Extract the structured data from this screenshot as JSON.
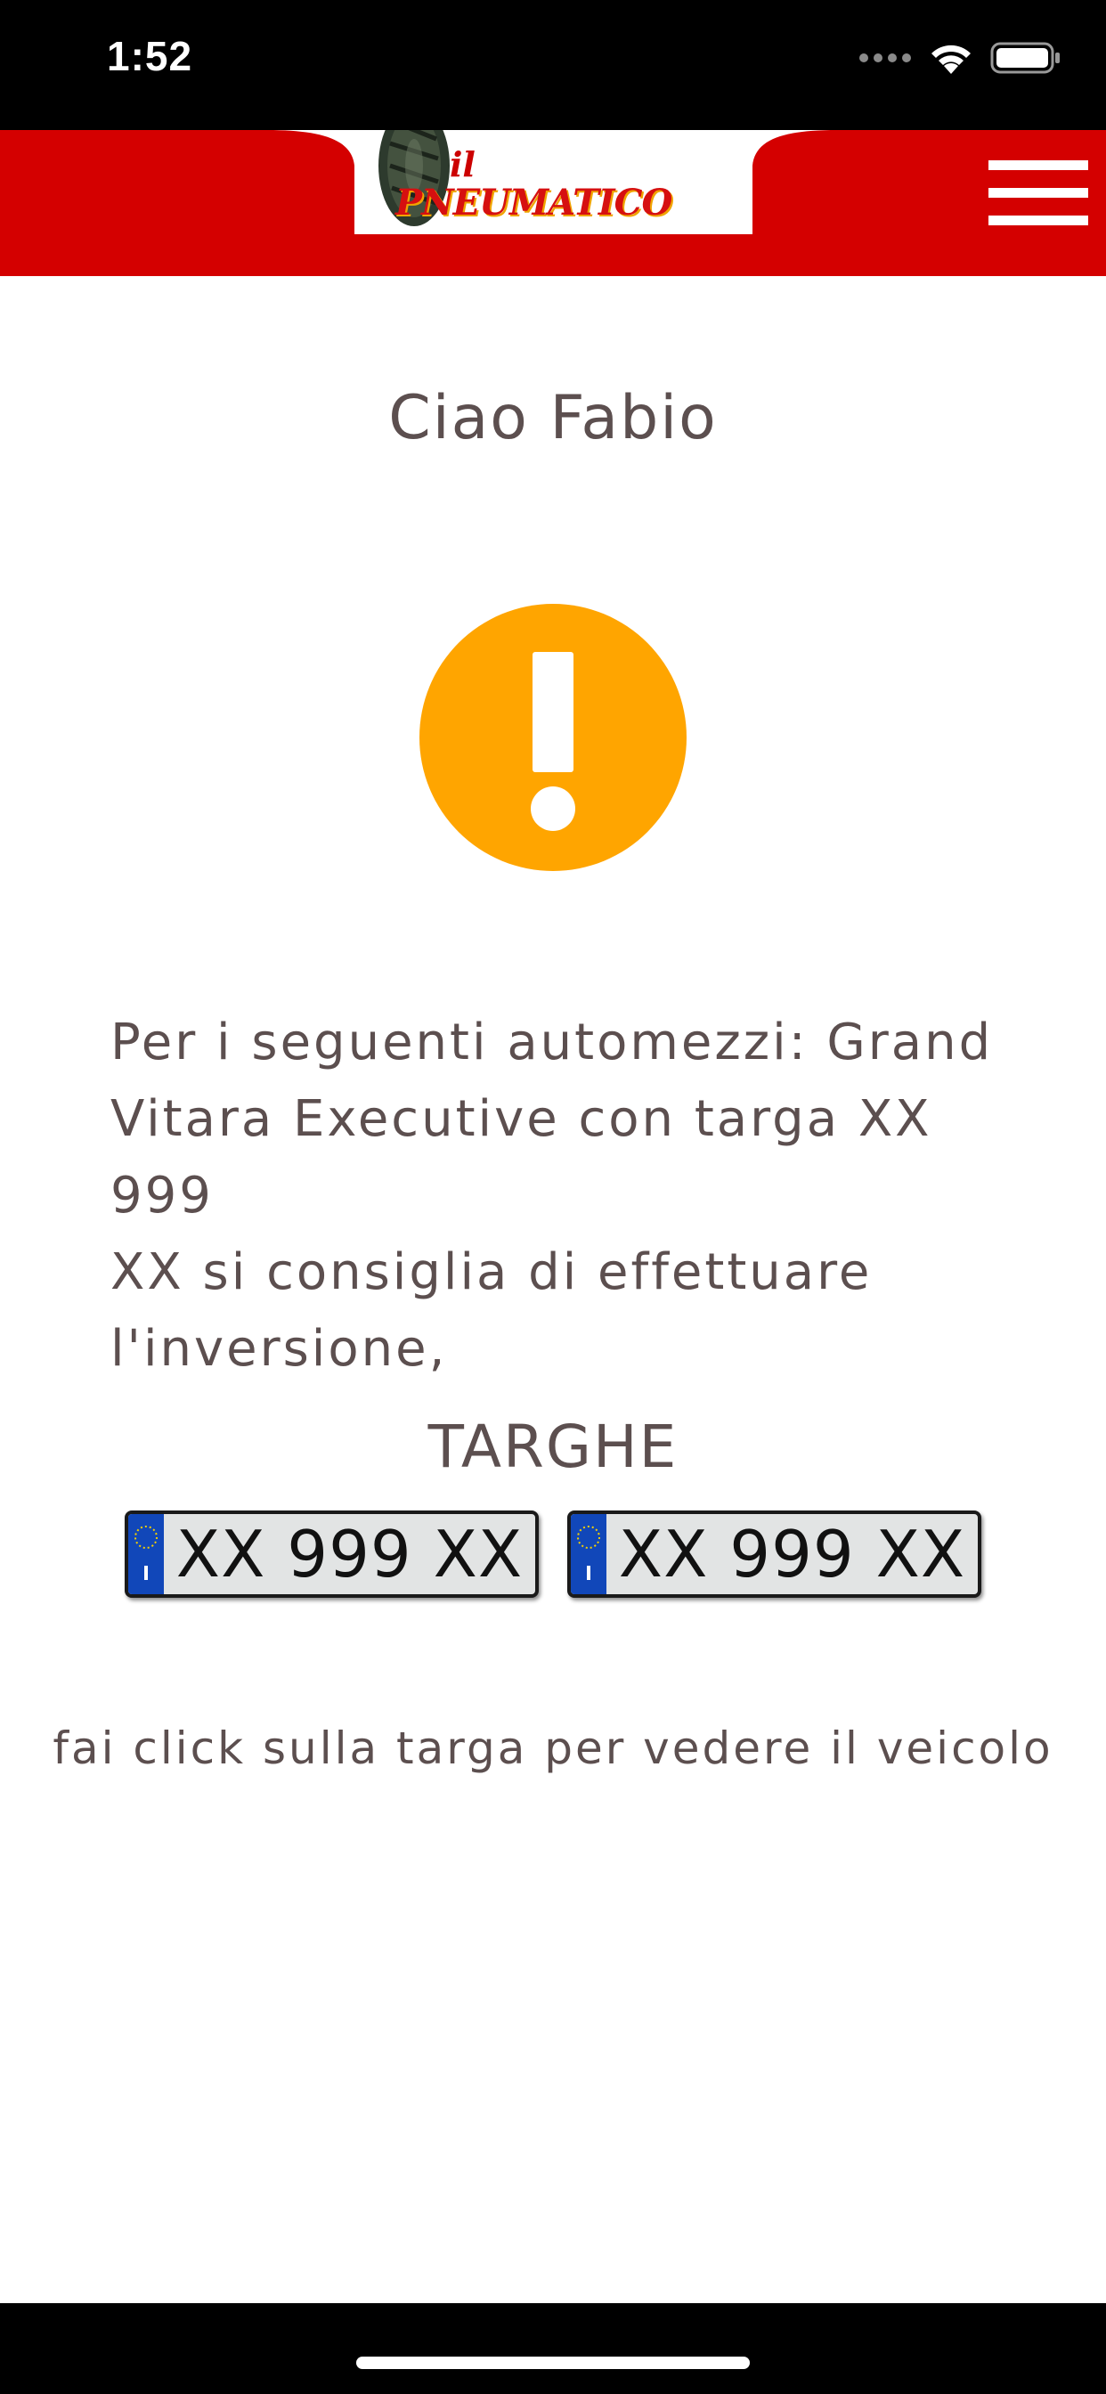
{
  "status_bar": {
    "time": "1:52",
    "icons": [
      "signal-dots-icon",
      "wifi-icon",
      "battery-icon"
    ]
  },
  "header": {
    "logo_text_small": "il",
    "logo_text_main": "PNEUMATICO",
    "menu_icon": "hamburger-menu-icon",
    "colors": {
      "background": "#d40000",
      "logo_red": "#d61010",
      "logo_orange": "#f0a400"
    }
  },
  "main": {
    "greeting": "Ciao Fabio",
    "alert_icon": "exclamation-circle-icon",
    "alert_color": "#ffa500",
    "message_lines": [
      "Per i seguenti automezzi: Grand",
      "Vitara Executive con targa XX 999",
      "XX si consiglia di effettuare",
      "l'inversione,"
    ],
    "plates_title": "TARGHE",
    "plates": [
      {
        "text": "XX 999 XX"
      },
      {
        "text": "XX 999 XX"
      }
    ],
    "hint": "fai click sulla targa per vedere il veicolo",
    "text_color": "#5c4f4f"
  }
}
